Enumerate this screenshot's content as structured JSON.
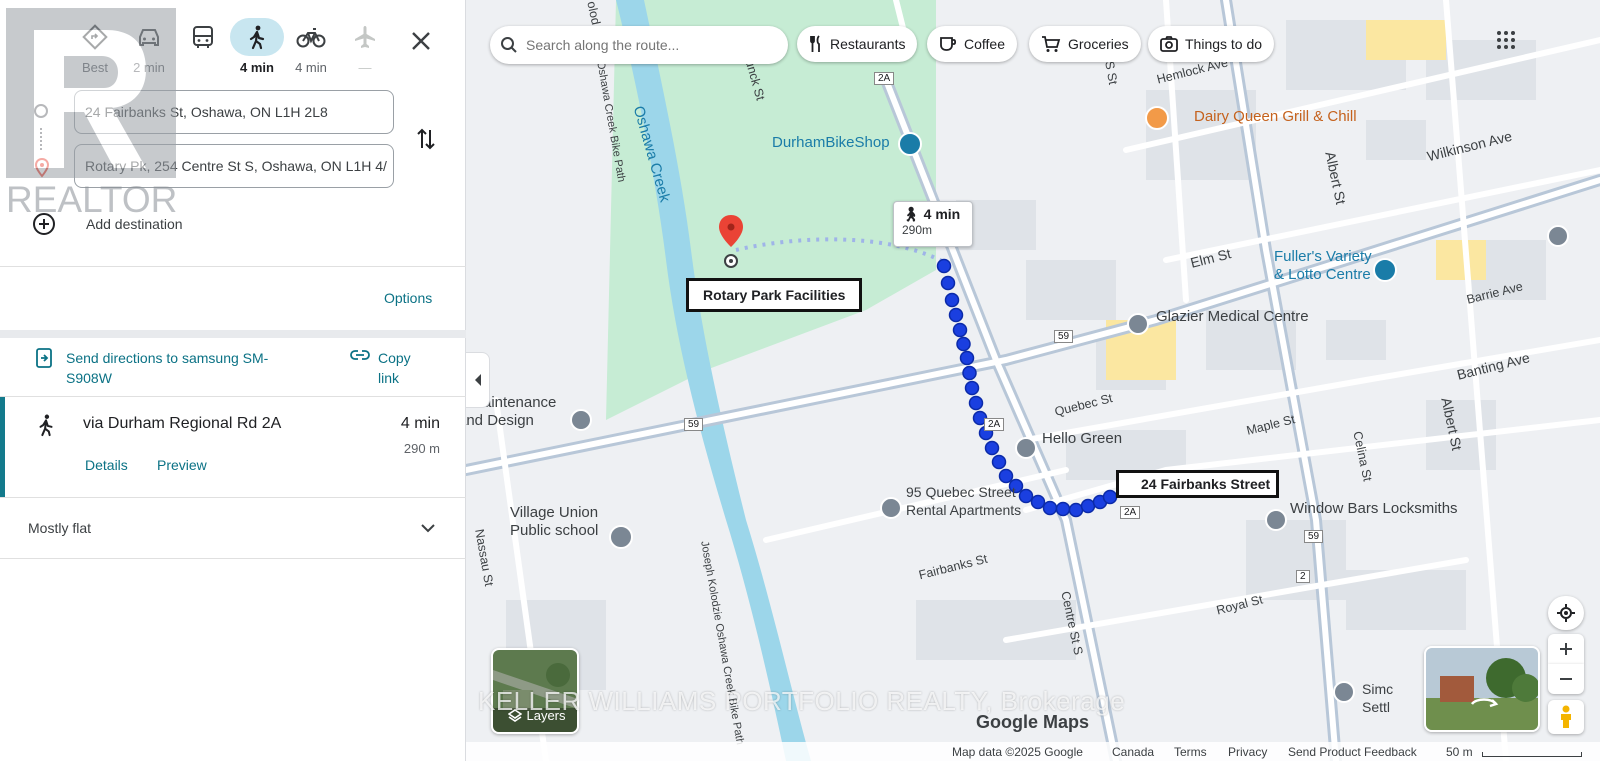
{
  "travel_modes": [
    {
      "name": "best",
      "label": "Best"
    },
    {
      "name": "drive",
      "label": "2 min"
    },
    {
      "name": "transit",
      "label": ""
    },
    {
      "name": "walk",
      "label": "4 min"
    },
    {
      "name": "cycle",
      "label": "4 min"
    },
    {
      "name": "flight",
      "label": "—"
    }
  ],
  "directions": {
    "origin": "24 Fairbanks St, Oshawa, ON L1H 2L8",
    "destination": "Rotary Pk, 254 Centre St S, Oshawa, ON L1H 4/",
    "add_destination": "Add destination",
    "options": "Options"
  },
  "share": {
    "send_label": "Send directions to samsung SM-S908W",
    "copy_label": "Copy link"
  },
  "route": {
    "via": "via Durham Regional Rd 2A",
    "time": "4 min",
    "distance": "290 m",
    "details": "Details",
    "preview": "Preview",
    "elevation": "Mostly flat"
  },
  "watermark_logo": "REALTOR",
  "map": {
    "search_placeholder": "Search along the route...",
    "chips": [
      "Restaurants",
      "Coffee",
      "Groceries",
      "Things to do"
    ],
    "route_bubble": {
      "time": "4 min",
      "distance": "290m"
    },
    "destination_callout": "Rotary Park Facilities",
    "origin_callout": "24 Fairbanks Street",
    "pois": {
      "dairy_queen": "Dairy Queen Grill & Chill",
      "bike_shop": "DurhamBikeShop",
      "fullers_1": "Fuller's Variety",
      "fullers_2": "& Lotto Centre",
      "glazier": "Glazier Medical Centre",
      "hello_green": "Hello Green",
      "quebec_1": "95 Quebec Street",
      "quebec_2": "Rental Apartments",
      "window_bars": "Window Bars Locksmiths",
      "maintenance_1": "e Maintenance",
      "maintenance_2": "and Design",
      "village_1": "Village Union",
      "village_2": "Public school",
      "simc": "Simc",
      "settl": "Settl"
    },
    "streets": {
      "hemlock": "Hemlock Ave",
      "wilkinson": "Wilkinson Ave",
      "elm": "Elm St",
      "barrie": "Barrie Ave",
      "banting": "Banting Ave",
      "maple": "Maple St",
      "quebec": "Quebec St",
      "fairbanks": "Fairbanks St",
      "royal": "Royal St",
      "albert1": "Albert St",
      "albert2": "Albert St",
      "celina": "Celina St",
      "centre": "Centre St S",
      "nassau": "Nassau St",
      "oshawa_creek": "Oshawa Creek",
      "bike_path": "Oshawa Creek Bike Path",
      "joseph": "Joseph Kolodzie Oshawa Creek Bike Path",
      "brunck": "unck St",
      "s_st": "S St",
      "olod": "olod"
    },
    "road_shields": [
      "2A",
      "59",
      "59",
      "2A",
      "2A",
      "59",
      "2"
    ],
    "layers_label": "Layers",
    "google_maps": "Google Maps",
    "listing_watermark": "KELLER WILLIAMS PORTFOLIO REALTY, Brokerage",
    "attribution": {
      "map_data": "Map data ©2025 Google",
      "country": "Canada",
      "terms": "Terms",
      "privacy": "Privacy",
      "feedback": "Send Product Feedback",
      "scale": "50 m"
    }
  },
  "colors": {
    "accent": "#0b7285",
    "route": "#1a3fe0",
    "park": "#c6ecd4",
    "water": "#9cd6ea",
    "pin": "#ea4335"
  }
}
